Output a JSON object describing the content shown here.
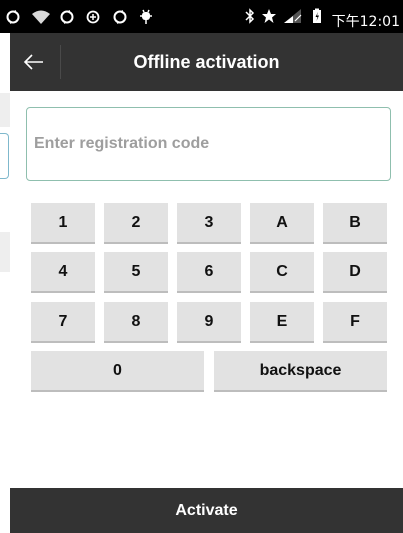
{
  "status_bar": {
    "time": "下午12:01",
    "left_icons": [
      "sync-icon",
      "wifi-icon",
      "sync-icon",
      "data-saver-icon",
      "sync-icon",
      "android-debug-icon"
    ],
    "right_icons": [
      "bluetooth-icon",
      "star-icon",
      "signal-icon",
      "battery-icon"
    ]
  },
  "app_bar": {
    "title": "Offline activation",
    "back_icon": "arrow-left-icon"
  },
  "registration": {
    "placeholder": "Enter registration code",
    "value": ""
  },
  "keypad": {
    "row1": [
      "1",
      "2",
      "3",
      "A",
      "B"
    ],
    "row2": [
      "4",
      "5",
      "6",
      "C",
      "D"
    ],
    "row3": [
      "7",
      "8",
      "9",
      "E",
      "F"
    ],
    "zero": "0",
    "backspace": "backspace"
  },
  "activate_label": "Activate",
  "colors": {
    "app_bar": "#333333",
    "input_border": "#8fbfae",
    "key_bg": "#e2e2e2"
  }
}
